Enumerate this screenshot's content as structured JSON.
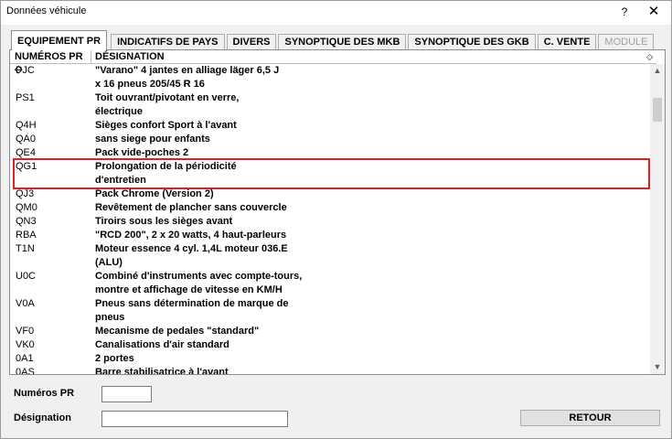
{
  "window": {
    "title": "Données véhicule",
    "help_label": "?",
    "close_label": "✕"
  },
  "tabs": [
    {
      "label": "EQUIPEMENT PR",
      "active": true
    },
    {
      "label": "INDICATIFS DE PAYS"
    },
    {
      "label": "DIVERS"
    },
    {
      "label": "SYNOPTIQUE DES MKB"
    },
    {
      "label": "SYNOPTIQUE DES GKB"
    },
    {
      "label": "C. VENTE"
    },
    {
      "label": "MODULE",
      "disabled": true
    }
  ],
  "table": {
    "col1_header": "NUMÉROS PR ◇",
    "col2_header": "DÉSIGNATION",
    "col2_sort_icon": "◇",
    "rows": [
      {
        "code": "PJC",
        "lines": [
          "\"Varano\" 4 jantes en alliage läger 6,5 J",
          " x 16 pneus 205/45 R 16"
        ]
      },
      {
        "code": "PS1",
        "lines": [
          "Toit ouvrant/pivotant en verre,",
          "électrique"
        ]
      },
      {
        "code": "Q4H",
        "lines": [
          "Sièges confort Sport à l'avant"
        ]
      },
      {
        "code": "QA0",
        "lines": [
          "sans siege pour enfants"
        ]
      },
      {
        "code": "QE4",
        "lines": [
          "Pack vide-poches 2"
        ]
      },
      {
        "code": "QG1",
        "lines": [
          "Prolongation de la périodicité",
          "d'entretien"
        ]
      },
      {
        "code": "QJ3",
        "lines": [
          "Pack Chrome (Version 2)"
        ]
      },
      {
        "code": "QM0",
        "lines": [
          "Revêtement de plancher sans couvercle"
        ]
      },
      {
        "code": "QN3",
        "lines": [
          "Tiroirs sous les sièges avant"
        ]
      },
      {
        "code": "RBA",
        "lines": [
          "\"RCD 200\", 2 x 20 watts, 4 haut-parleurs"
        ]
      },
      {
        "code": "T1N",
        "lines": [
          "Moteur essence 4 cyl. 1,4L moteur 036.E",
          "(ALU)"
        ]
      },
      {
        "code": "U0C",
        "lines": [
          "Combiné d'instruments avec compte-tours,",
          "montre et affichage de vitesse en KM/H"
        ]
      },
      {
        "code": "V0A",
        "lines": [
          "Pneus sans détermination de marque de",
          "pneus"
        ]
      },
      {
        "code": "VF0",
        "lines": [
          "Mecanisme de pedales \"standard\""
        ]
      },
      {
        "code": "VK0",
        "lines": [
          "Canalisations d'air standard"
        ]
      },
      {
        "code": "0A1",
        "lines": [
          "2 portes"
        ]
      },
      {
        "code": "0AS",
        "lines": [
          "Barre stabilisatrice à l'avant"
        ]
      }
    ],
    "selected_code": "QG1",
    "highlight_color": "#e02020"
  },
  "scrollbar": {
    "up_icon": "▲",
    "down_icon": "▼"
  },
  "form": {
    "numeros_label": "Numéros PR",
    "numeros_value": "",
    "designation_label": "Désignation",
    "designation_value": "",
    "retour_label": "RETOUR"
  }
}
